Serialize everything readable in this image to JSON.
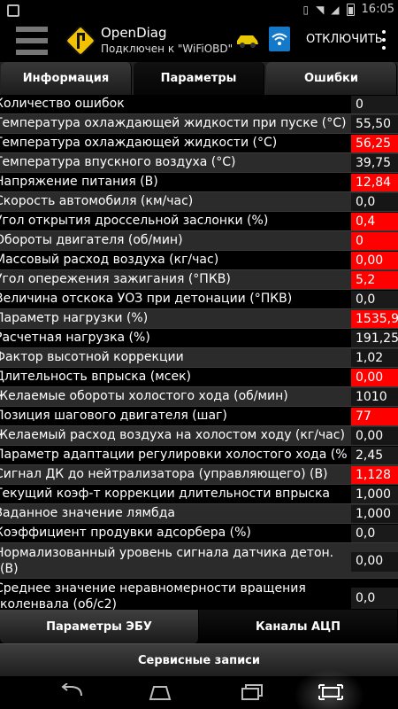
{
  "app": {
    "title": "OpenDiag",
    "subtitle": "Подключен к \"WiFiOBD\"",
    "disconnect_label": "ОТКЛЮЧИТЬ"
  },
  "status_bar": {
    "time": "16:05",
    "icons": [
      "image-icon",
      "vibrate-icon",
      "wifi-signal-icon",
      "no-signal-icon",
      "battery-icon"
    ]
  },
  "tabs": [
    {
      "label": "Информация",
      "active": false
    },
    {
      "label": "Параметры",
      "active": true
    },
    {
      "label": "Ошибки",
      "active": false
    }
  ],
  "parameters": [
    {
      "label": "Количество ошибок",
      "value": "0",
      "alert": false
    },
    {
      "label": "Температура охлаждающей жидкости при пуске (°C)",
      "value": "55,50",
      "alert": false
    },
    {
      "label": "Температура охлаждающей жидкости (°C)",
      "value": "56,25",
      "alert": true
    },
    {
      "label": "Температура впускного воздуха (°C)",
      "value": "39,75",
      "alert": false
    },
    {
      "label": "Напряжение питания (В)",
      "value": "12,84",
      "alert": true
    },
    {
      "label": "Скорость автомобиля (км/час)",
      "value": "0,0",
      "alert": false
    },
    {
      "label": "Угол открытия дроссельной заслонки (%)",
      "value": "0,4",
      "alert": true
    },
    {
      "label": "Обороты двигателя (об/мин)",
      "value": "0",
      "alert": true
    },
    {
      "label": "Массовый расход воздуха (кг/час)",
      "value": "0,00",
      "alert": true
    },
    {
      "label": "Угол опережения зажигания (°ПКВ)",
      "value": "5,2",
      "alert": true
    },
    {
      "label": "Величина отскока УОЗ при детонации (°ПКВ)",
      "value": "0,0",
      "alert": false
    },
    {
      "label": "Параметр нагрузки (%)",
      "value": "1535,98",
      "alert": true
    },
    {
      "label": "Расчетная нагрузка (%)",
      "value": "191,25",
      "alert": false
    },
    {
      "label": "Фактор высотной коррекции",
      "value": "1,02",
      "alert": false
    },
    {
      "label": "Длительность впрыска (мсек)",
      "value": "0,00",
      "alert": true
    },
    {
      "label": "Желаемые обороты холостого хода (об/мин)",
      "value": "1010",
      "alert": false
    },
    {
      "label": "Позиция шагового двигателя (шаг)",
      "value": "77",
      "alert": true
    },
    {
      "label": "Желаемый расход воздуха на холостом ходу (кг/час)",
      "value": "0,00",
      "alert": false
    },
    {
      "label": "Параметр адаптации регулировки холостого хода (%)",
      "value": "2,45",
      "alert": false
    },
    {
      "label": "Сигнал ДК до нейтрализатора (управляющего) (В)",
      "value": "1,128",
      "alert": true
    },
    {
      "label": "Текущий коэф-т коррекции длительности впрыска",
      "value": "1,000",
      "alert": false
    },
    {
      "label": "Заданное значение лямбда",
      "value": "1,000",
      "alert": false
    },
    {
      "label": "Коэффициент продувки адсорбера (%)",
      "value": "0,0",
      "alert": false
    },
    {
      "label": "Нормализованный уровень сигнала датчика детон. (В)",
      "value": "0,00",
      "alert": false,
      "tall": true
    },
    {
      "label": "Среднее значение неравномерности вращения коленвала (об/с2)",
      "value": "0,0",
      "alert": false,
      "tall": true
    }
  ],
  "bottom_tabs": [
    {
      "label": "Параметры ЭБУ",
      "active": false
    },
    {
      "label": "Каналы АЦП",
      "active": true
    }
  ],
  "service_button": "Сервисные записи",
  "colors": {
    "alert": "#ff0000",
    "wifi_badge": "#1479c9",
    "car_icon": "#e8c800",
    "logo": "#f2c200"
  }
}
